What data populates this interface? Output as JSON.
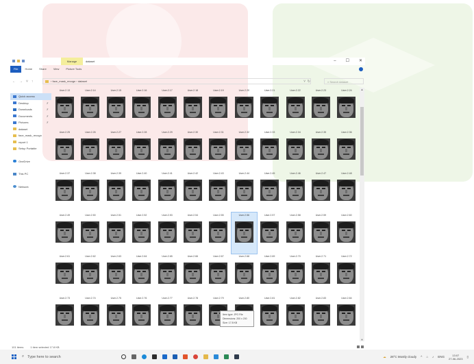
{
  "window": {
    "title": "dataset",
    "contextual_tab": "Manage",
    "controls": [
      "–",
      "☐",
      "✕"
    ]
  },
  "ribbon": {
    "tabs": [
      "File",
      "Home",
      "Share",
      "View",
      "Picture Tools"
    ]
  },
  "address": {
    "path": [
      "face_mask_recogn",
      "dataset"
    ],
    "search_placeholder": "Search dataset"
  },
  "nav": {
    "items": [
      {
        "label": "Quick access",
        "icon": "star-icon",
        "selected": true
      },
      {
        "label": "Desktop",
        "icon": "desktop-icon",
        "pinned": true
      },
      {
        "label": "Downloads",
        "icon": "download-icon",
        "pinned": true
      },
      {
        "label": "Documents",
        "icon": "documents-icon",
        "pinned": true
      },
      {
        "label": "Pictures",
        "icon": "pictures-icon",
        "pinned": true
      },
      {
        "label": "dataset",
        "icon": "folder-icon"
      },
      {
        "label": "face_mask_recogn",
        "icon": "folder-icon"
      },
      {
        "label": "report 1",
        "icon": "folder-icon"
      },
      {
        "label": "Setup Portable",
        "icon": "folder-icon"
      },
      {
        "label": "OneDrive",
        "icon": "cloud-icon"
      },
      {
        "label": "This PC",
        "icon": "computer-icon"
      },
      {
        "label": "Network",
        "icon": "network-icon"
      }
    ]
  },
  "files": {
    "rows": [
      [
        "User.2.13",
        "User.2.14",
        "User.2.15",
        "User.2.16",
        "User.2.17",
        "User.2.18",
        "User.2.19",
        "User.2.20",
        "User.2.21",
        "User.2.22",
        "User.2.23",
        "User.2.24"
      ],
      [
        "User.2.25",
        "User.2.26",
        "User.2.27",
        "User.2.28",
        "User.2.29",
        "User.2.30",
        "User.2.31",
        "User.2.32",
        "User.2.33",
        "User.2.34",
        "User.2.35",
        "User.2.36"
      ],
      [
        "User.2.37",
        "User.2.38",
        "User.2.39",
        "User.2.40",
        "User.2.41",
        "User.2.42",
        "User.2.43",
        "User.2.44",
        "User.2.45",
        "User.2.46",
        "User.2.47",
        "User.2.48"
      ],
      [
        "User.2.49",
        "User.2.50",
        "User.2.51",
        "User.2.52",
        "User.2.53",
        "User.2.54",
        "User.2.55",
        "User.2.56",
        "User.2.57",
        "User.2.58",
        "User.2.59",
        "User.2.60"
      ],
      [
        "User.2.61",
        "User.2.62",
        "User.2.63",
        "User.2.64",
        "User.2.65",
        "User.2.66",
        "User.2.67",
        "User.2.68",
        "User.2.69",
        "User.2.70",
        "User.2.71",
        "User.2.72"
      ],
      [
        "User.2.73",
        "User.2.74",
        "User.2.75",
        "User.2.76",
        "User.2.77",
        "User.2.78",
        "User.2.79",
        "User.2.80",
        "User.2.81",
        "User.2.82",
        "User.2.83",
        "User.2.84"
      ],
      [
        "",
        "",
        "",
        "",
        "",
        "",
        "",
        "",
        "",
        "",
        "",
        ""
      ]
    ],
    "selected": "User.2.56"
  },
  "tooltip": {
    "line1": "Item type: JPG File",
    "line2": "Dimensions: 200 x 200",
    "line3": "Size: 17.8 KB"
  },
  "status": {
    "count": "101 items",
    "selection": "1 item selected  17.8 KB"
  },
  "taskbar": {
    "search_placeholder": "Type here to search",
    "weather": "28°C  Mostly cloudy",
    "lang": "ENG",
    "time": "13:07",
    "date": "27-06-2023"
  },
  "colors": {
    "file_tab": "#1c5dbf",
    "manage_tab": "#f4ee9c",
    "selection": "#cce0f7"
  }
}
